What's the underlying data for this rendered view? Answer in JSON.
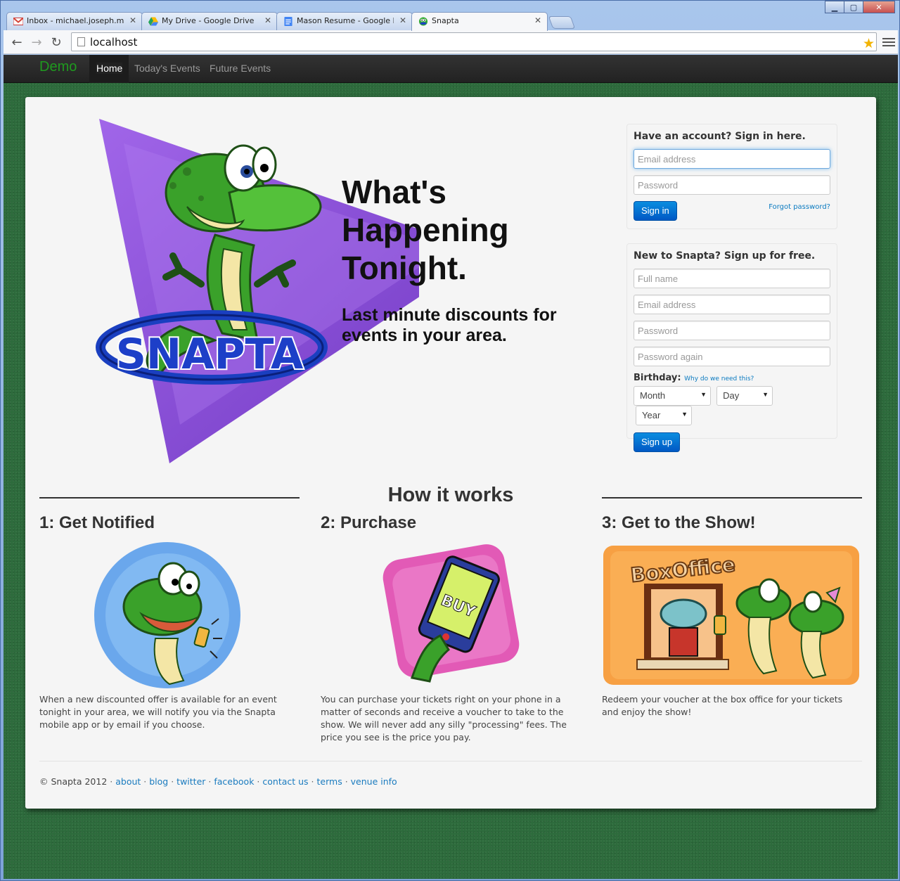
{
  "window": {
    "controls": {
      "minimize": "▁",
      "maximize": "▢",
      "close": "✕"
    }
  },
  "tabs": [
    {
      "title": "Inbox - michael.joseph.maso",
      "icon": "gmail-icon",
      "color": "#d44638"
    },
    {
      "title": "My Drive - Google Drive",
      "icon": "google-drive-icon",
      "color": "#1fa463"
    },
    {
      "title": "Mason Resume - Google Driv",
      "icon": "google-docs-icon",
      "color": "#4285f4"
    },
    {
      "title": "Snapta",
      "icon": "snapta-icon",
      "color": "#5a3"
    }
  ],
  "toolbar": {
    "url": "localhost"
  },
  "nav": {
    "brand": "Demo",
    "links": [
      "Home",
      "Today's Events",
      "Future Events"
    ],
    "active": "Home",
    "brand_color": "#1f9a1f"
  },
  "hero": {
    "logo_text": "SNAPTA",
    "heading": "What's Happening Tonight.",
    "subheading": "Last minute discounts for events in your area."
  },
  "signin": {
    "title": "Have an account? Sign in here.",
    "email_placeholder": "Email address",
    "password_placeholder": "Password",
    "button": "Sign in",
    "forgot": "Forgot password?"
  },
  "signup": {
    "title": "New to Snapta? Sign up for free.",
    "fullname_placeholder": "Full name",
    "email_placeholder": "Email address",
    "password_placeholder": "Password",
    "password_again_placeholder": "Password again",
    "birthday_label": "Birthday:",
    "birthday_why": "Why do we need this?",
    "month": "Month",
    "day": "Day",
    "year": "Year",
    "button": "Sign up"
  },
  "how": {
    "title": "How it works",
    "steps": [
      {
        "title": "1: Get Notified",
        "text": "When a new discounted offer is available for an event tonight in your area, we will notify you via the Snapta mobile app or by email if you choose."
      },
      {
        "title": "2: Purchase",
        "text": "You can purchase your tickets right on your phone in a matter of seconds and receive a voucher to take to the show. We will never add any silly \"processing\" fees. The price you see is the price you pay."
      },
      {
        "title": "3: Get to the Show!",
        "text": "Redeem your voucher at the box office for your tickets and enjoy the show!"
      }
    ],
    "art_labels": {
      "phone_screen": "BUY",
      "box_office": "BoxOffice"
    }
  },
  "footer": {
    "copyright": "© Snapta 2012",
    "links": [
      "about",
      "blog",
      "twitter",
      "facebook",
      "contact us",
      "terms",
      "venue info"
    ]
  },
  "colors": {
    "page_bg": "#2d6b3c",
    "accent": "#0a7ac0",
    "button": "#0a6fd6",
    "hero_purple": "#8a4fd6"
  }
}
